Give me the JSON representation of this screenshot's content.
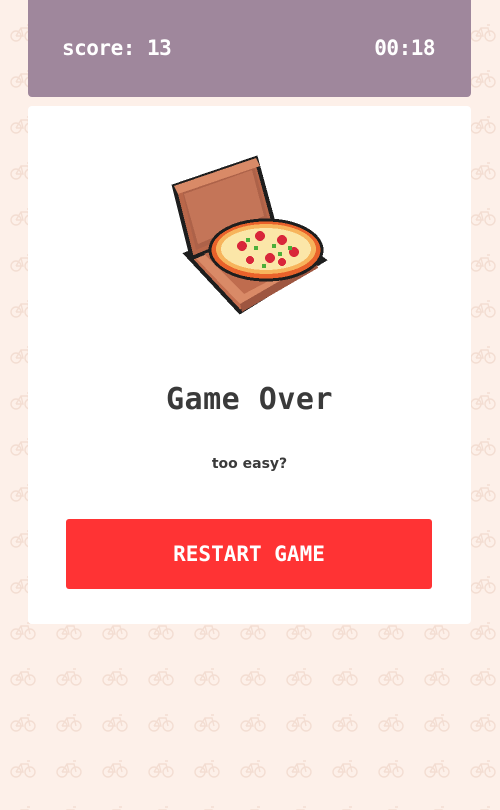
{
  "hud": {
    "score_label": "score: 13",
    "timer": "00:18"
  },
  "result": {
    "illustration": "pizza-box-icon",
    "title": "Game Over",
    "subtitle": "too easy?",
    "restart_label": "RESTART GAME"
  },
  "colors": {
    "background": "#fdf0e9",
    "pattern": "#f6e2d8",
    "hud": "#9f879c",
    "panel": "#ffffff",
    "button": "#ff3334",
    "text": "#3a3a3a"
  }
}
